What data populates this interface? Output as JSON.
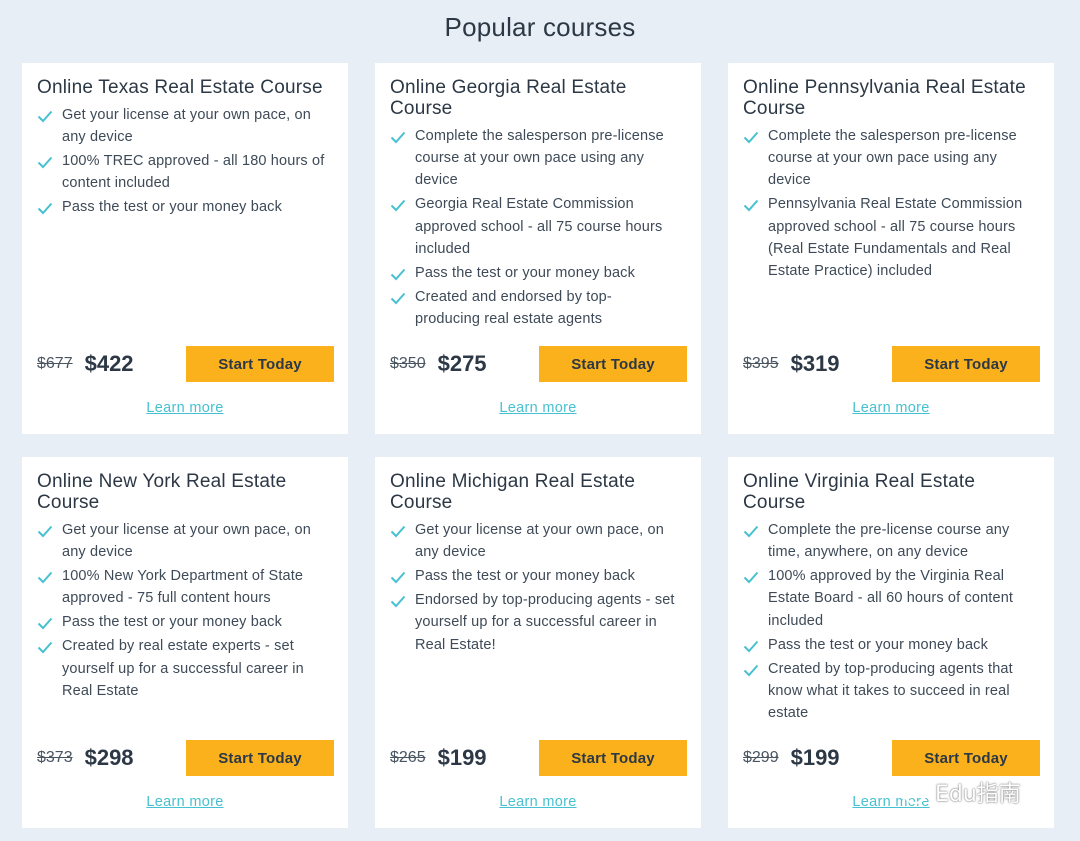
{
  "page": {
    "title": "Popular courses"
  },
  "colors": {
    "accent_button": "#fbb11b",
    "link": "#47c1d1",
    "check": "#47c1d1",
    "background": "#e8eef5"
  },
  "cards": [
    {
      "title": "Online Texas Real Estate Course",
      "features": [
        "Get your license at your own pace, on any device",
        "100% TREC approved - all 180 hours of content included",
        "Pass the test or your money back"
      ],
      "old_price": "$677",
      "price": "$422",
      "button_label": "Start Today",
      "link_label": "Learn more"
    },
    {
      "title": "Online Georgia Real Estate Course",
      "features": [
        "Complete the salesperson pre-license course at your own pace using any device",
        "Georgia Real Estate Commission approved school - all 75 course hours included",
        "Pass the test or your money back",
        "Created and endorsed by top-producing real estate agents"
      ],
      "old_price": "$350",
      "price": "$275",
      "button_label": "Start Today",
      "link_label": "Learn more"
    },
    {
      "title": "Online Pennsylvania Real Estate Course",
      "features": [
        "Complete the salesperson pre-license course at your own pace using any device",
        "Pennsylvania Real Estate Commission approved school - all 75 course hours (Real Estate Fundamentals and Real Estate Practice) included"
      ],
      "old_price": "$395",
      "price": "$319",
      "button_label": "Start Today",
      "link_label": "Learn more"
    },
    {
      "title": "Online New York Real Estate Course",
      "features": [
        "Get your license at your own pace, on any device",
        "100% New York Department of State approved - 75 full content hours",
        "Pass the test or your money back",
        "Created by real estate experts - set yourself up for a successful career in Real Estate"
      ],
      "old_price": "$373",
      "price": "$298",
      "button_label": "Start Today",
      "link_label": "Learn more"
    },
    {
      "title": "Online Michigan Real Estate Course",
      "features": [
        "Get your license at your own pace, on any device",
        "Pass the test or your money back",
        "Endorsed by top-producing agents - set yourself up for a successful career in Real Estate!"
      ],
      "old_price": "$265",
      "price": "$199",
      "button_label": "Start Today",
      "link_label": "Learn more"
    },
    {
      "title": "Online Virginia Real Estate Course",
      "features": [
        "Complete the pre-license course any time, anywhere, on any device",
        "100% approved by the Virginia Real Estate Board - all 60 hours of content included",
        "Pass the test or your money back",
        "Created by top-producing agents that know what it takes to succeed in real estate"
      ],
      "old_price": "$299",
      "price": "$199",
      "button_label": "Start Today",
      "link_label": "Learn more"
    }
  ],
  "watermark": {
    "text": "Edu指南",
    "icon": "wechat-icon"
  }
}
